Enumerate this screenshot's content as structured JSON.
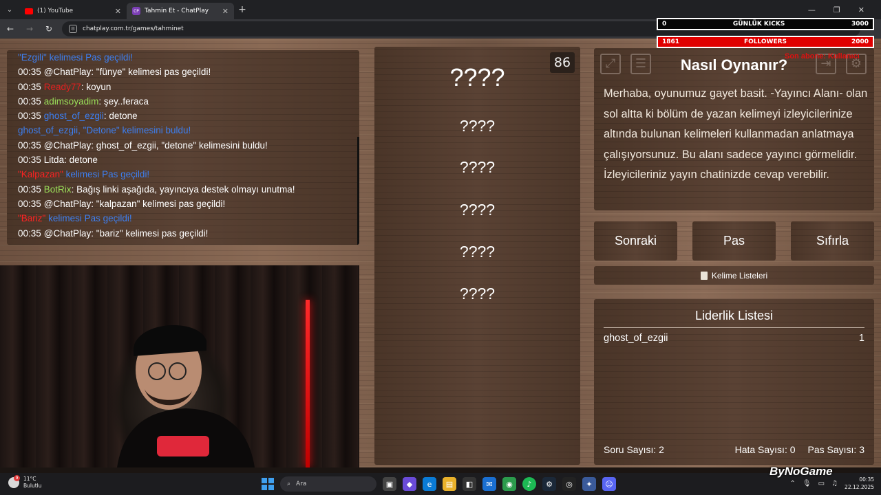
{
  "browser": {
    "tabs": [
      {
        "title": "(1) YouTube",
        "active": false
      },
      {
        "title": "Tahmin Et - ChatPlay",
        "active": true
      }
    ],
    "url": "chatplay.com.tr/games/tahminet",
    "new_tab": "+"
  },
  "chat": {
    "lines": [
      {
        "time": "",
        "user": "",
        "user_color": "#ff2222",
        "text": "\"Ezgili\" kelimesi Pas geçildi!",
        "text_color": "#3d7ff0"
      },
      {
        "time": "00:35",
        "user": "@ChatPlay",
        "user_color": "#ffffff",
        "text": ": \"fünye\" kelimesi pas geçildi!",
        "text_color": "#ffffff"
      },
      {
        "time": "00:35",
        "user": "Ready77",
        "user_color": "#e02020",
        "text": ": koyun",
        "text_color": "#ffffff"
      },
      {
        "time": "00:35",
        "user": "adimsoyadim",
        "user_color": "#9be05a",
        "text": ": şey..feraca",
        "text_color": "#ffffff"
      },
      {
        "time": "00:35",
        "user": "ghost_of_ezgii",
        "user_color": "#3d7ff0",
        "text": ": detone",
        "text_color": "#ffffff"
      },
      {
        "time": "",
        "user": "ghost_of_ezgii,",
        "user_color": "#3d7ff0",
        "text": " \"Detone\" kelimesini buldu!",
        "text_color": "#3d7ff0"
      },
      {
        "time": "00:35",
        "user": "@ChatPlay",
        "user_color": "#ffffff",
        "text": ": ghost_of_ezgii, \"detone\" kelimesini buldu!",
        "text_color": "#ffffff"
      },
      {
        "time": "00:35",
        "user": "Litda",
        "user_color": "#ffffff",
        "text": ": detone",
        "text_color": "#ffffff"
      },
      {
        "time": "",
        "user": "\"Kalpazan\"",
        "user_color": "#ff2222",
        "text": " kelimesi Pas geçildi!",
        "text_color": "#3d7ff0"
      },
      {
        "time": "00:35",
        "user": "BotRix",
        "user_color": "#9be05a",
        "text": ": Bağış linki aşağıda, yayıncıya destek olmayı unutma!",
        "text_color": "#ffffff"
      },
      {
        "time": "00:35",
        "user": "@ChatPlay",
        "user_color": "#ffffff",
        "text": ": \"kalpazan\" kelimesi pas geçildi!",
        "text_color": "#ffffff"
      },
      {
        "time": "",
        "user": "\"Bariz\"",
        "user_color": "#ff2222",
        "text": " kelimesi Pas geçildi!",
        "text_color": "#3d7ff0"
      },
      {
        "time": "00:35",
        "user": "@ChatPlay",
        "user_color": "#ffffff",
        "text": ": \"bariz\" kelimesi pas geçildi!",
        "text_color": "#ffffff"
      }
    ]
  },
  "game": {
    "timer": "86",
    "words": [
      "????",
      "????",
      "????",
      "????",
      "????",
      "????"
    ]
  },
  "info": {
    "title": "Nasıl Oynanır?",
    "text": "Merhaba, oyunumuz gayet basit. -Yayıncı Alanı- olan sol altta ki bölüm de yazan kelimeyi izleyicilerinize altında bulunan kelimeleri kullanmadan anlatmaya çalışıyorsunuz. Bu alanı sadece yayıncı görmelidir. İzleyicileriniz yayın chatinizde cevap verebilir."
  },
  "controls": {
    "next": "Sonraki",
    "pass": "Pas",
    "reset": "Sıfırla",
    "word_lists": "Kelime Listeleri"
  },
  "leaderboard": {
    "title": "Liderlik Listesi",
    "rows": [
      {
        "name": "ghost_of_ezgii",
        "score": "1"
      }
    ],
    "stats": {
      "questions": "Soru Sayısı: 2",
      "errors": "Hata Sayısı: 0",
      "passes": "Pas Sayısı: 3"
    }
  },
  "overlay": {
    "kicks_value": "0",
    "kicks_label": "GÜNLÜK KICKS",
    "kicks_goal": "3000",
    "followers_value": "1861",
    "followers_label": "FOLLOWERS",
    "followers_goal": "2000",
    "sub_text": "Son abone: Kullanıcı",
    "brand": "ByNoGame"
  },
  "taskbar": {
    "temp": "11°C",
    "weather": "Bulutlu",
    "weather_badge": "9",
    "search": "Ara",
    "time": "00:35",
    "date": "22.12.2025"
  },
  "colors": {
    "wood_panel": "#4f392c",
    "link_blue": "#3d7ff0",
    "alert_red": "#e00000",
    "bot_green": "#9be05a"
  }
}
